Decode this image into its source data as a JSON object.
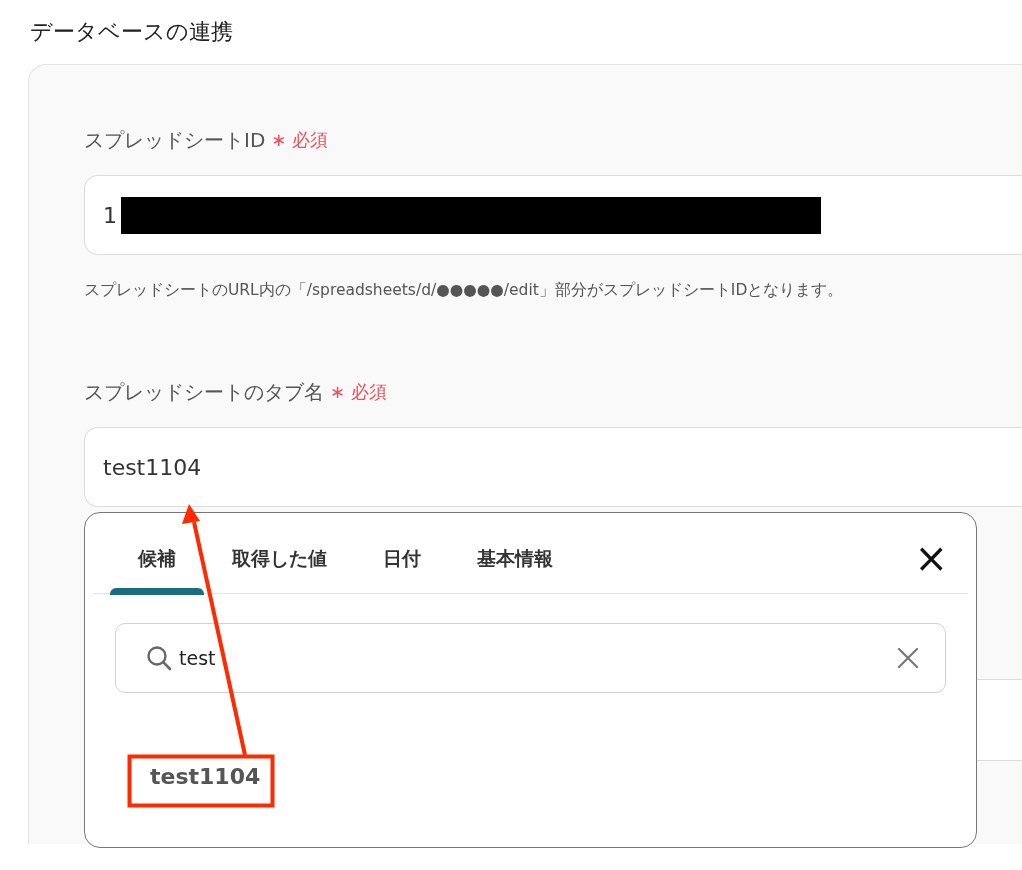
{
  "section_title": "データベースの連携",
  "fields": [
    {
      "label": "スプレッドシートID",
      "required_mark": "∗",
      "required_text": "必須",
      "value": "1",
      "redacted": true,
      "help": "スプレッドシートのURL内の「/spreadsheets/d/●●●●●/edit」部分がスプレッドシートIDとなります。"
    },
    {
      "label": "スプレッドシートのタブ名",
      "required_mark": "∗",
      "required_text": "必須",
      "value": "test1104"
    }
  ],
  "popup": {
    "tabs": [
      {
        "label": "候補",
        "selected": true
      },
      {
        "label": "取得した値",
        "selected": false
      },
      {
        "label": "日付",
        "selected": false
      },
      {
        "label": "基本情報",
        "selected": false
      }
    ],
    "close": "×",
    "search": {
      "value": "test"
    },
    "results": [
      {
        "label": "test1104",
        "highlighted": true
      }
    ]
  }
}
